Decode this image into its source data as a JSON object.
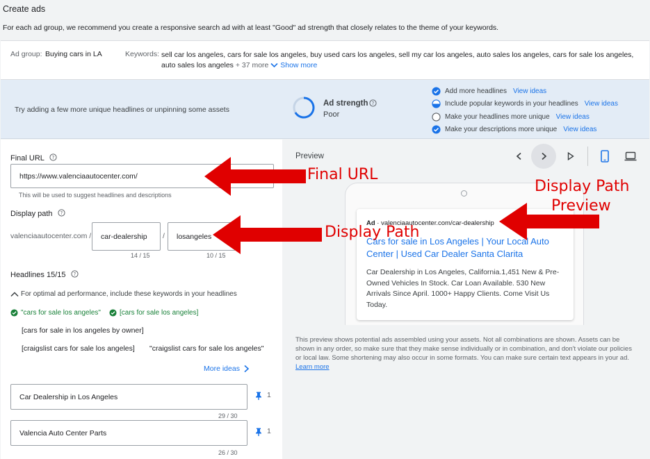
{
  "page": {
    "title": "Create ads",
    "description": "For each ad group, we recommend you create a responsive search ad with at least \"Good\" ad strength that closely relates to the theme of your keywords."
  },
  "ad_group": {
    "label": "Ad group:",
    "value": "Buying cars in LA",
    "keywords_label": "Keywords:",
    "keywords": "sell car los angeles, cars for sale los angeles, buy used cars los angeles, sell my car los angeles, auto sales los angeles, cars for sale los angeles, auto sales los angeles",
    "more_count": "+ 37 more",
    "show_more": "Show more"
  },
  "ad_strength": {
    "tip": "Try adding a few more unique headlines or unpinning some assets",
    "label": "Ad strength",
    "value": "Poor",
    "checklist": [
      {
        "text": "Add more headlines",
        "link": "View ideas",
        "state": "done"
      },
      {
        "text": "Include popular keywords in your headlines",
        "link": "View ideas",
        "state": "partial"
      },
      {
        "text": "Make your headlines more unique",
        "link": "View ideas",
        "state": "todo"
      },
      {
        "text": "Make your descriptions more unique",
        "link": "View ideas",
        "state": "done"
      }
    ]
  },
  "form": {
    "final_url_label": "Final URL",
    "final_url_value": "https://www.valenciaautocenter.com/",
    "final_url_hint": "This will be used to suggest headlines and descriptions",
    "display_path_label": "Display path",
    "display_path_domain": "valenciaautocenter.com /",
    "path1_value": "car-dealership",
    "path1_count": "14 / 15",
    "path2_value": "losangeles",
    "path2_count": "10 / 15",
    "headlines_label": "Headlines 15/15",
    "headlines_hint": "For optimal ad performance, include these keywords in your headlines",
    "kw_suggest_1": "\"cars for sale los angeles\"",
    "kw_suggest_2": "[cars for sale los angeles]",
    "kw_plain_1": "[cars for sale in los angeles by owner]",
    "kw_plain_2": "[craigslist cars for sale los angeles]",
    "kw_plain_3": "\"craigslist cars for sale los angeles\"",
    "more_ideas": "More ideas",
    "headline_1": "Car Dealership in Los Angeles",
    "headline_1_count": "29 / 30",
    "headline_1_pin": "1",
    "headline_2": "Valencia Auto Center Parts",
    "headline_2_count": "26 / 30",
    "headline_2_pin": "1"
  },
  "preview": {
    "label": "Preview",
    "ad_tag": "Ad",
    "ad_url": " · valenciaautocenter.com/car-dealership",
    "headline": "Cars for sale in Los Angeles | Your Local Auto Center | Used Car Dealer Santa Clarita",
    "body": "Car Dealership in Los Angeles, California.1,451 New & Pre-Owned Vehicles In Stock. Car Loan Available. 530 New Arrivals Since April. 1000+ Happy Clients. Come Visit Us Today.",
    "note": "This preview shows potential ads assembled using your assets. Not all combinations are shown. Assets can be shown in any order, so make sure that they make sense individually or in combination, and don't violate our policies or local law. Some shortening may also occur in some formats. You can make sure certain text appears in your ad.",
    "learn_more": "Learn more"
  },
  "annotations": {
    "final_url": "Final URL",
    "display_path": "Display Path",
    "preview_line1": "Display Path",
    "preview_line2": "Preview"
  },
  "colors": {
    "link": "#1a73e8",
    "annotation": "#e00000",
    "ok_green": "#188038",
    "strength_bg": "#e3ecf6"
  }
}
